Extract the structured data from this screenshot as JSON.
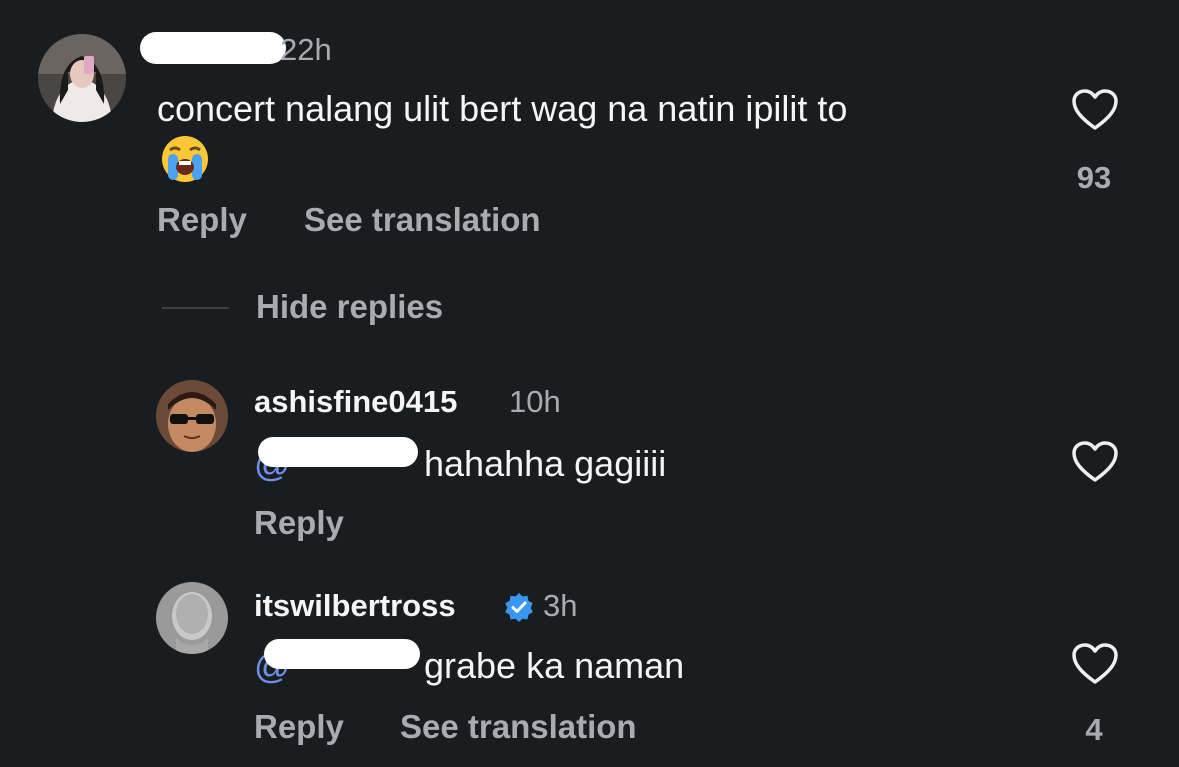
{
  "comment": {
    "username": "",
    "time": "22h",
    "text": "concert nalang ulit bert wag na natin ipilit to",
    "emoji": "loudly-crying-face",
    "like_count": "93",
    "reply_label": "Reply",
    "translate_label": "See translation",
    "hide_replies_label": "Hide replies"
  },
  "replies": [
    {
      "username": "ashisfine0415",
      "time": "10h",
      "mention": "@",
      "text": "hahahha gagiiii",
      "reply_label": "Reply"
    },
    {
      "username": "itswilbertross",
      "verified": true,
      "time": "3h",
      "mention": "@",
      "text": "grabe ka naman",
      "like_count": "4",
      "reply_label": "Reply",
      "translate_label": "See translation"
    }
  ],
  "colors": {
    "background": "#1a1d20",
    "mention": "#6e8fe8",
    "secondary_text": "#a8abb0",
    "verified": "#3897f0"
  }
}
